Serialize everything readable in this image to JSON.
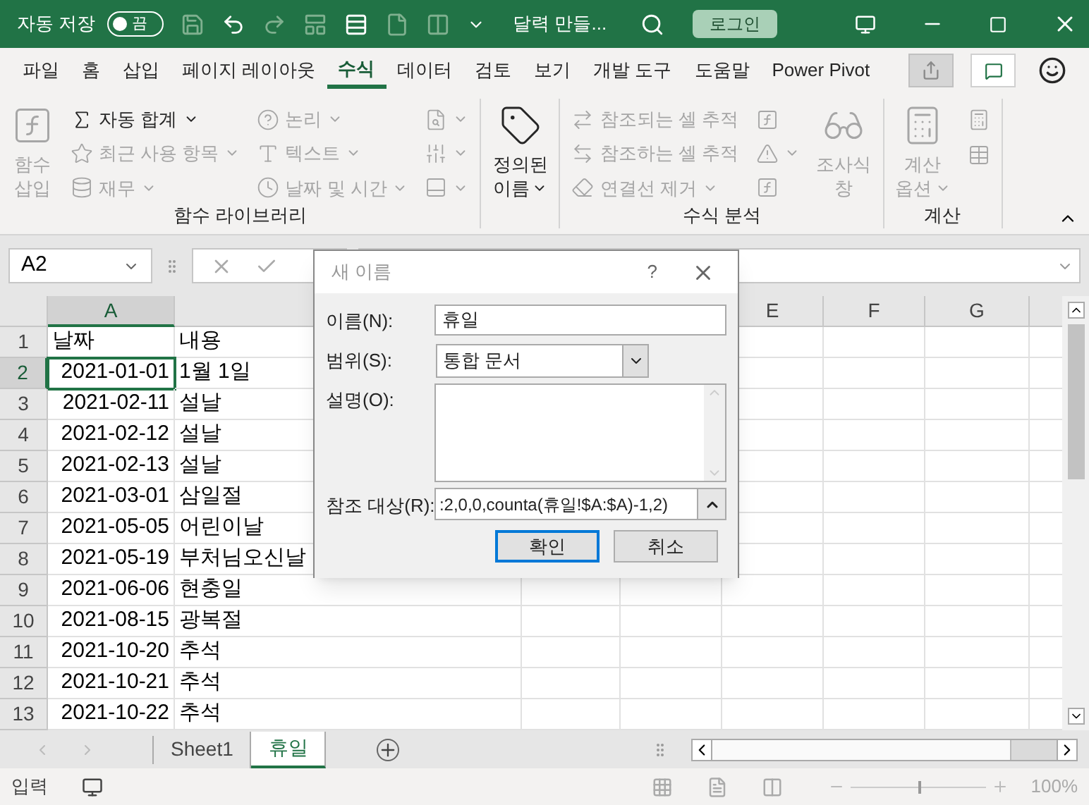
{
  "title_bar": {
    "autosave_label": "자동 저장",
    "autosave_on": false,
    "autosave_state": "끔",
    "document_title": "달력 만들...",
    "sign_in": "로그인"
  },
  "ribbon_tabs": [
    {
      "label": "파일",
      "selected": false
    },
    {
      "label": "홈",
      "selected": false
    },
    {
      "label": "삽입",
      "selected": false
    },
    {
      "label": "페이지 레이아웃",
      "selected": false
    },
    {
      "label": "수식",
      "selected": true
    },
    {
      "label": "데이터",
      "selected": false
    },
    {
      "label": "검토",
      "selected": false
    },
    {
      "label": "보기",
      "selected": false
    },
    {
      "label": "개발 도구",
      "selected": false
    },
    {
      "label": "도움말",
      "selected": false
    },
    {
      "label": "Power Pivot",
      "selected": false
    }
  ],
  "ribbon_groups": [
    {
      "label": "함수 라이브러리",
      "columns": [
        {
          "kind": "large",
          "items": [
            {
              "lines": [
                "함수",
                "삽입"
              ],
              "disabled": true,
              "dropdown": false
            }
          ]
        },
        {
          "kind": "stack",
          "items": [
            {
              "label": "자동 합계",
              "disabled": false,
              "dropdown": true
            },
            {
              "label": "최근 사용 항목",
              "disabled": true,
              "dropdown": true
            },
            {
              "label": "재무",
              "disabled": true,
              "dropdown": true
            }
          ]
        },
        {
          "kind": "stack",
          "items": [
            {
              "label": "논리",
              "disabled": true,
              "dropdown": true
            },
            {
              "label": "텍스트",
              "disabled": true,
              "dropdown": true
            },
            {
              "label": "날짜 및 시간",
              "disabled": true,
              "dropdown": true
            }
          ]
        },
        {
          "kind": "stack",
          "items": [
            {
              "disabled": true,
              "dropdown": true
            },
            {
              "disabled": true,
              "dropdown": true
            },
            {
              "disabled": true,
              "dropdown": true
            }
          ]
        }
      ]
    },
    {
      "columns": [
        {
          "kind": "large",
          "items": [
            {
              "lines": [
                "정의된",
                "이름"
              ],
              "disabled": false,
              "dropdown": true
            }
          ]
        }
      ]
    },
    {
      "label": "수식 분석",
      "columns": [
        {
          "kind": "stack",
          "items": [
            {
              "label": "참조되는 셀 추적",
              "disabled": true,
              "dropdown": false
            },
            {
              "label": "참조하는 셀 추적",
              "disabled": true,
              "dropdown": false
            },
            {
              "label": "연결선 제거",
              "disabled": true,
              "dropdown": true
            }
          ]
        },
        {
          "kind": "stack",
          "items": [
            {
              "disabled": true,
              "dropdown": false
            },
            {
              "disabled": true,
              "dropdown": true
            },
            {
              "disabled": true,
              "dropdown": false
            }
          ]
        },
        {
          "kind": "large",
          "items": [
            {
              "lines": [
                "조사식",
                "창"
              ],
              "disabled": true,
              "dropdown": false
            }
          ]
        }
      ]
    },
    {
      "label": "계산",
      "columns": [
        {
          "kind": "large",
          "items": [
            {
              "lines": [
                "계산",
                "옵션"
              ],
              "disabled": true,
              "dropdown": true
            }
          ]
        },
        {
          "kind": "stack",
          "items": [
            {
              "disabled": true,
              "dropdown": false
            },
            {
              "disabled": true,
              "dropdown": false
            }
          ]
        }
      ]
    }
  ],
  "formula_bar": {
    "name_box": "A2"
  },
  "columns": [
    {
      "label": "A",
      "selected": true
    },
    {
      "label": "E",
      "selected": false
    },
    {
      "label": "F",
      "selected": false
    },
    {
      "label": "G",
      "selected": false
    }
  ],
  "rows": [
    {
      "row": "1",
      "kind": "heading",
      "selected": false,
      "cells": [
        "날짜",
        "내용"
      ]
    },
    {
      "row": "2",
      "kind": "entry",
      "selected": true,
      "cells": [
        "2021-01-01",
        "1월 1일"
      ]
    },
    {
      "row": "3",
      "kind": "entry",
      "selected": false,
      "cells": [
        "2021-02-11",
        "설날"
      ]
    },
    {
      "row": "4",
      "kind": "entry",
      "selected": false,
      "cells": [
        "2021-02-12",
        "설날"
      ]
    },
    {
      "row": "5",
      "kind": "entry",
      "selected": false,
      "cells": [
        "2021-02-13",
        "설날"
      ]
    },
    {
      "row": "6",
      "kind": "entry",
      "selected": false,
      "cells": [
        "2021-03-01",
        "삼일절"
      ]
    },
    {
      "row": "7",
      "kind": "entry",
      "selected": false,
      "cells": [
        "2021-05-05",
        "어린이날"
      ]
    },
    {
      "row": "8",
      "kind": "entry",
      "selected": false,
      "cells": [
        "2021-05-19",
        "부처님오신날"
      ]
    },
    {
      "row": "9",
      "kind": "entry",
      "selected": false,
      "cells": [
        "2021-06-06",
        "현충일"
      ]
    },
    {
      "row": "10",
      "kind": "entry",
      "selected": false,
      "cells": [
        "2021-08-15",
        "광복절"
      ]
    },
    {
      "row": "11",
      "kind": "entry",
      "selected": false,
      "cells": [
        "2021-10-20",
        "추석"
      ]
    },
    {
      "row": "12",
      "kind": "entry",
      "selected": false,
      "cells": [
        "2021-10-21",
        "추석"
      ]
    },
    {
      "row": "13",
      "kind": "entry",
      "selected": false,
      "cells": [
        "2021-10-22",
        "추석"
      ]
    }
  ],
  "sheet_tabs": [
    {
      "label": "Sheet1",
      "selected": false
    },
    {
      "label": "휴일",
      "selected": true
    }
  ],
  "status_bar": {
    "mode": "입력",
    "level": 0.5,
    "zoom": "100%"
  },
  "dialog": {
    "title": "새 이름",
    "help": "?",
    "name_label": "이름(N):",
    "name_value": "휴일",
    "scope_label": "범위(S):",
    "scope_value": "통합 문서",
    "comment_label": "설명(O):",
    "refers_label": "참조 대상(R):",
    "refers_value": ":2,0,0,counta(휴일!$A:$A)-1,2)",
    "ok": "확인",
    "cancel": "취소"
  }
}
